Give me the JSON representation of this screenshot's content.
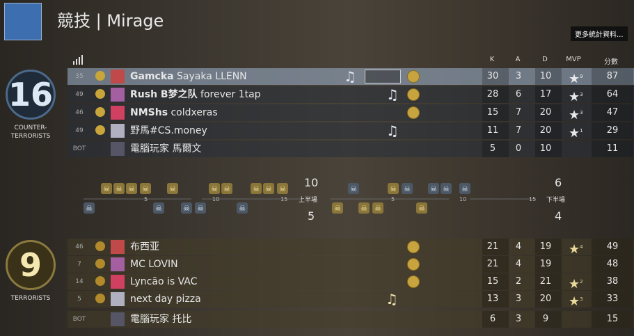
{
  "header": {
    "title": "競技 | Mirage",
    "more_button": "更多統計資料..."
  },
  "teams": {
    "ct": {
      "score": "16",
      "name": "COUNTER-\nTERRORISTS",
      "name_line1": "COUNTER-",
      "name_line2": "TERRORISTS"
    },
    "t": {
      "score": "9",
      "name": "TERRORISTS"
    }
  },
  "columns": {
    "k": "K",
    "a": "A",
    "d": "D",
    "mvp": "MVP",
    "score": "分數"
  },
  "ct_players": [
    {
      "rank": "35",
      "name_bold": "Gamcka",
      "name_rest": " Sayaka LLENN",
      "k": "30",
      "a": "3",
      "d": "10",
      "mvp": "9",
      "score": "87"
    },
    {
      "rank": "49",
      "name_bold": "Rush B梦之队",
      "name_rest": " forever 1tap",
      "k": "28",
      "a": "6",
      "d": "17",
      "mvp": "3",
      "score": "64"
    },
    {
      "rank": "46",
      "name_bold": "NMShs",
      "name_rest": " coldxeras",
      "k": "15",
      "a": "7",
      "d": "20",
      "mvp": "3",
      "score": "47"
    },
    {
      "rank": "49",
      "name_bold": "",
      "name_rest": "野馬#CS.money",
      "k": "11",
      "a": "7",
      "d": "20",
      "mvp": "1",
      "score": "29"
    },
    {
      "rank": "BOT",
      "name_bold": "",
      "name_rest": "電腦玩家 馬爾文",
      "k": "5",
      "a": "0",
      "d": "10",
      "mvp": "",
      "score": "11"
    }
  ],
  "t_players": [
    {
      "rank": "46",
      "name": "布西亚",
      "k": "21",
      "a": "4",
      "d": "19",
      "mvp": "4",
      "score": "49"
    },
    {
      "rank": "7",
      "name": "MC LOVIN",
      "k": "21",
      "a": "4",
      "d": "19",
      "mvp": "",
      "score": "48"
    },
    {
      "rank": "14",
      "name": "Lyncão is VAC",
      "k": "15",
      "a": "2",
      "d": "21",
      "mvp": "2",
      "score": "38"
    },
    {
      "rank": "5",
      "name": "next day pizza",
      "k": "13",
      "a": "3",
      "d": "20",
      "mvp": "3",
      "score": "33"
    },
    {
      "rank": "BOT",
      "name": "電腦玩家 托比",
      "k": "6",
      "a": "3",
      "d": "9",
      "mvp": "",
      "score": "15"
    }
  ],
  "halves": {
    "first": {
      "label": "上半場",
      "ct_score": "10",
      "t_score": "5"
    },
    "second": {
      "label": "下半場",
      "ct_score": "6",
      "t_score": "4"
    }
  },
  "ticks": [
    "5",
    "10",
    "15"
  ],
  "colors": {
    "ct": "#4d5866",
    "t": "#8a7638",
    "selected_row": "#96aac3"
  }
}
